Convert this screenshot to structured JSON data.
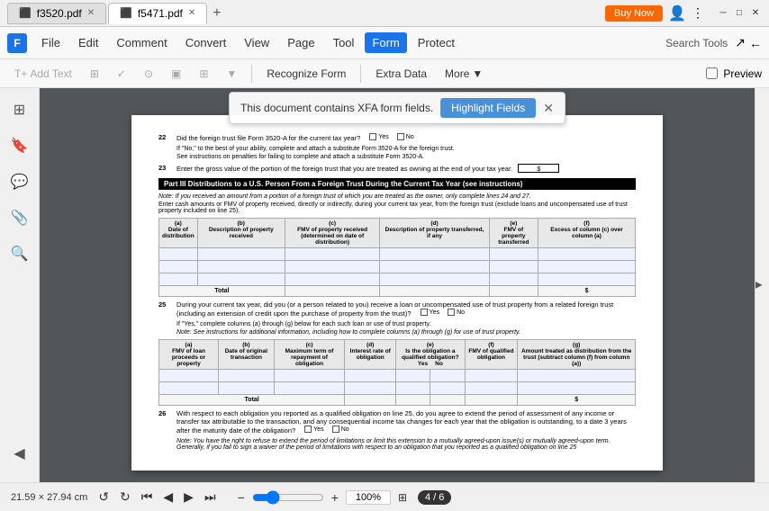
{
  "titleBar": {
    "tabs": [
      {
        "id": "tab1",
        "label": "f3520.pdf",
        "active": false
      },
      {
        "id": "tab2",
        "label": "f5471.pdf",
        "active": true
      }
    ],
    "newTabBtn": "+",
    "buyNow": "Buy Now",
    "windowControls": {
      "minimize": "─",
      "maximize": "□",
      "close": "✕"
    }
  },
  "menuBar": {
    "items": [
      {
        "id": "file",
        "label": "File"
      },
      {
        "id": "edit",
        "label": "Edit"
      },
      {
        "id": "comment",
        "label": "Comment"
      },
      {
        "id": "convert",
        "label": "Convert"
      },
      {
        "id": "view",
        "label": "View"
      },
      {
        "id": "page",
        "label": "Page"
      },
      {
        "id": "tool",
        "label": "Tool"
      },
      {
        "id": "form",
        "label": "Form",
        "active": true
      },
      {
        "id": "protect",
        "label": "Protect"
      }
    ],
    "searchTools": "Search Tools"
  },
  "toolbar": {
    "addText": "Add Text",
    "recognizeForm": "Recognize Form",
    "extraData": "Extra Data",
    "more": "More",
    "preview": "Preview"
  },
  "xfaBanner": {
    "message": "This document contains XFA form fields.",
    "highlightBtn": "Highlight Fields",
    "closeBtn": "✕"
  },
  "pdfContent": {
    "pageNumber": "4 / 6",
    "pageSize": "21.59 × 27.94 cm",
    "zoomLevel": "100%",
    "rows": [
      {
        "num": "22",
        "text": "Did the foreign trust file Form 3520-A for the current tax year?",
        "hasCheckbox": true
      }
    ],
    "ifNoText": "If \"No,\" to the best of your ability, complete and attach a substitute Form 3520-A for the foreign trust.",
    "seeInstructions": "See instructions on penalties for failing to complete and attach a substitute Form 3520-A.",
    "row23Text": "Enter the gross value of the portion of the foreign trust that you are treated as owning at the end of your tax year.",
    "partIIIHeader": "Part III   Distributions to a U.S. Person From a Foreign Trust During the Current Tax Year (see instructions)",
    "partIIINote": "Note: If you received an amount from a portion of a foreign trust of which you are treated as the owner, only complete lines 24 and 27.",
    "row24Text": "Enter cash amounts or FMV of property received, directly or indirectly, during your current tax year, from the foreign trust (exclude loans and uncompensated use of trust property included on line 25).",
    "tableHeaders24": [
      "(a)\nDate of distribution",
      "(b)\nDescription of property received",
      "(c)\nFMV of property received (determined on date of distribution)",
      "(d)\nDescription of property transferred, if any",
      "(e)\nFMV of property transferred",
      "(f)\nExcess of column (c) over column (a)"
    ],
    "totalLabel": "Total",
    "row25Text": "During your current tax year, did you (or a person related to you) receive a loan or uncompensated use of trust property from a related foreign trust (including an extension of credit upon the purchase of property from the trust)?",
    "row25IfYes": "If \"Yes,\" complete columns (a) through (g) below for each such loan or use of trust property.",
    "row25Note": "Note: See instructions for additional information, including how to complete columns (a) through (g) for use of trust property.",
    "tableHeaders25": [
      "(a)\nFMV of loan proceeds or property",
      "(b)\nDate of original transaction",
      "(c)\nMaximum term of repayment of obligation",
      "(d)\nInterest rate of obligation",
      "(e)\nIs the obligation a qualified obligation?\nYes | No",
      "(f)\nFMV of qualified obligation",
      "(g)\nAmount treated as distribution from the trust (subtract column (f) from column (a))"
    ],
    "row26Text": "With respect to each obligation you reported as a qualified obligation on line 25, do you agree to extend the period of assessment of any income or transfer tax attributable to the transaction, and any consequential income tax changes for each year that the obligation is outstanding, to a date 3 years after the maturity date of the obligation?",
    "row26NoteText": "Note: You have the right to refuse to extend the period of limitations or limit this extension to a mutually agreed-upon issue(s) or mutually agreed-upon term. Generally, if you fail to sign a waiver of the period of limitations with respect to an obligation that you reported as a qualified obligation on line 25"
  }
}
